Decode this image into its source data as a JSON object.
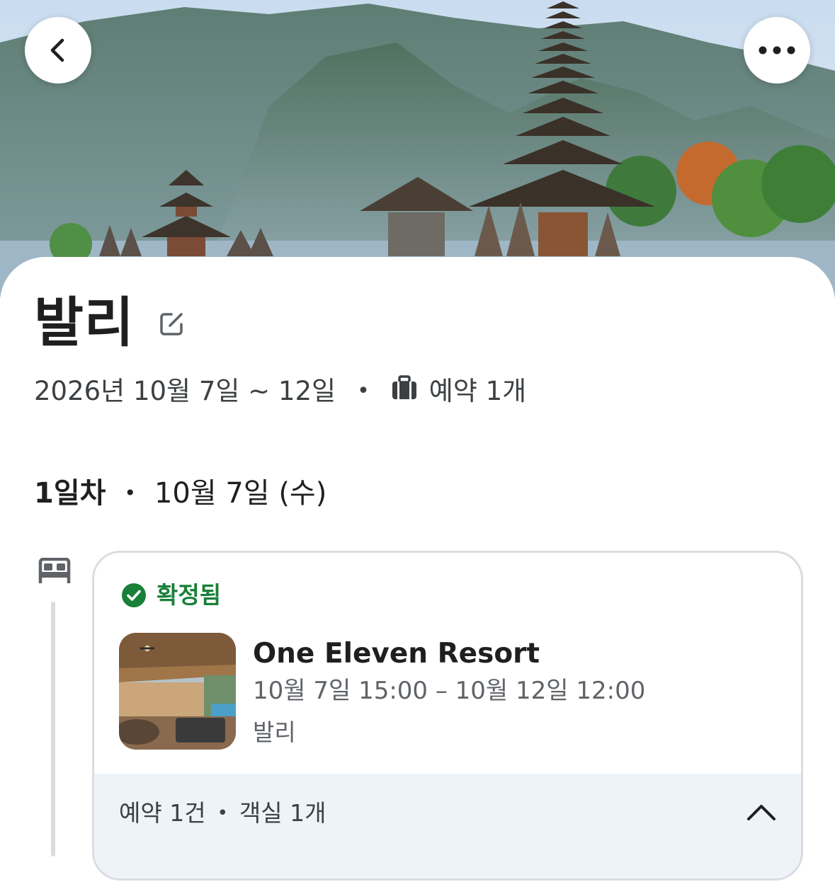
{
  "trip": {
    "title": "발리",
    "date_range": "2026년 10월 7일 ~ 12일",
    "separator": "•",
    "booking_count": "예약 1개"
  },
  "day": {
    "label": "1일차",
    "separator": "•",
    "date": "10월 7일 (수)"
  },
  "reservation": {
    "status": "확정됨",
    "hotel_name": "One Eleven Resort",
    "dates": "10월 7일 15:00 – 10월 12일 12:00",
    "location": "발리",
    "footer_bookings": "예약 1건",
    "footer_separator": "•",
    "footer_rooms": "객실 1개"
  },
  "icons": {
    "back": "chevron-left-icon",
    "more": "more-horizontal-icon",
    "edit": "edit-icon",
    "bag": "suitcase-icon",
    "bed": "bed-icon",
    "status": "check-circle-icon",
    "collapse": "chevron-up-icon"
  },
  "colors": {
    "confirmed": "#188038",
    "footer_bg": "#eef3fa",
    "border": "#dadce0"
  }
}
